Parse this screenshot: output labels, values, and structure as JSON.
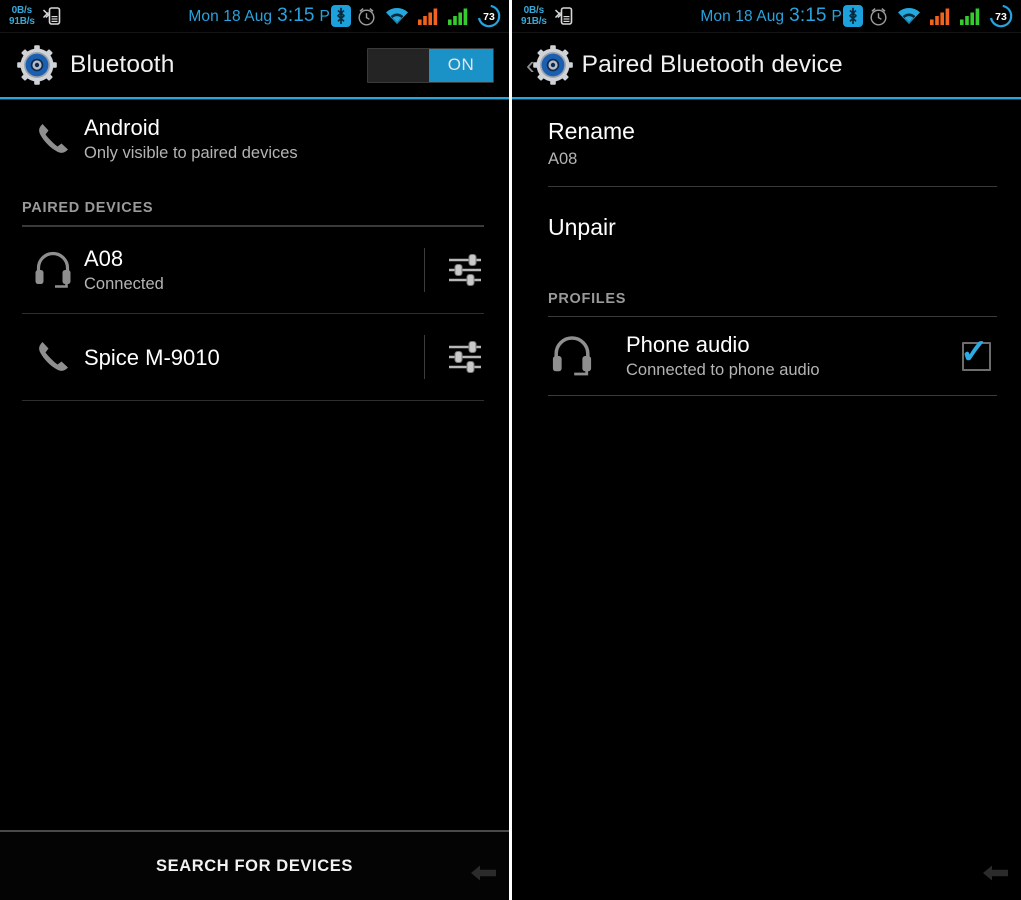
{
  "statusbar": {
    "net_up": "0B/s",
    "net_down": "91B/s",
    "tether_icon": "bluetooth-tether-icon",
    "date": "Mon 18 Aug",
    "time": "3:15",
    "ampm": "PM",
    "bluetooth_icon": "bluetooth-icon",
    "alarm_icon": "alarm-clock-icon",
    "wifi_icon": "wifi-icon",
    "signal1_icon": "signal-bars-icon",
    "signal2_icon": "signal-bars-icon",
    "battery_level": "73",
    "colors": {
      "accent": "#29a3dd",
      "netspeed": "#3ba7d6",
      "signal_orange": "#f4631c",
      "signal_green": "#33cc33",
      "alarm_gray": "#9a9a9a"
    }
  },
  "left_panel": {
    "actionbar": {
      "icon": "settings-gear-icon",
      "title": "Bluetooth",
      "switch": {
        "label": "ON",
        "state": "on",
        "on_color": "#1b92c7"
      }
    },
    "device_self": {
      "icon": "phone-icon",
      "name": "Android",
      "status": "Only visible to paired devices"
    },
    "section_header": "PAIRED DEVICES",
    "paired_devices": [
      {
        "icon": "headset-icon",
        "name": "A08",
        "status": "Connected",
        "settings_icon": "sliders-icon"
      },
      {
        "icon": "phone-icon",
        "name": "Spice M-9010",
        "status": "",
        "settings_icon": "sliders-icon"
      }
    ],
    "bottom_button": "SEARCH FOR DEVICES",
    "nav_back_icon": "back-arrow-icon"
  },
  "right_panel": {
    "actionbar": {
      "back_icon": "back-chevron-icon",
      "icon": "settings-gear-icon",
      "title": "Paired Bluetooth device"
    },
    "rename": {
      "label": "Rename",
      "value": "A08"
    },
    "unpair": {
      "label": "Unpair"
    },
    "section_header": "PROFILES",
    "profiles": [
      {
        "icon": "headset-icon",
        "name": "Phone audio",
        "status": "Connected to phone audio",
        "checked": true,
        "check_color": "#2daae1"
      }
    ],
    "nav_back_icon": "back-arrow-icon"
  }
}
